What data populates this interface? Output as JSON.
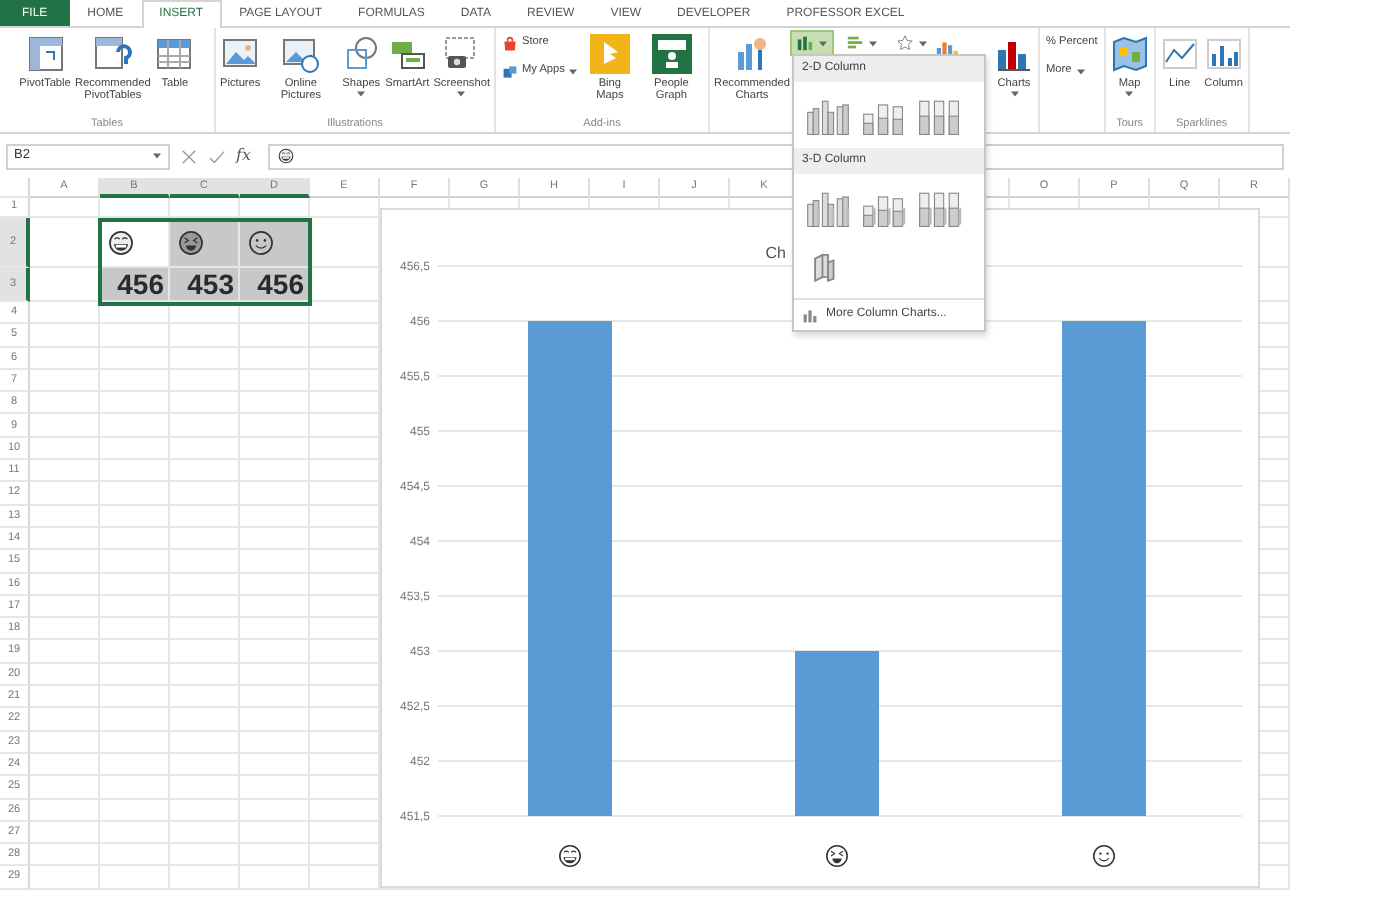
{
  "tabs": [
    {
      "label": "FILE",
      "kind": "file",
      "selected": false
    },
    {
      "label": "HOME",
      "kind": "tab",
      "selected": false
    },
    {
      "label": "INSERT",
      "kind": "tab",
      "selected": true
    },
    {
      "label": "PAGE LAYOUT",
      "kind": "tab",
      "selected": false
    },
    {
      "label": "FORMULAS",
      "kind": "tab",
      "selected": false
    },
    {
      "label": "DATA",
      "kind": "tab",
      "selected": false
    },
    {
      "label": "REVIEW",
      "kind": "tab",
      "selected": false
    },
    {
      "label": "VIEW",
      "kind": "tab",
      "selected": false
    },
    {
      "label": "DEVELOPER",
      "kind": "tab",
      "selected": false
    },
    {
      "label": "PROFESSOR EXCEL",
      "kind": "tab",
      "selected": false
    }
  ],
  "ribbon": {
    "groups": [
      {
        "label": "Tables",
        "buttons": [
          {
            "label": "PivotTable",
            "kind": "large",
            "caret": false,
            "expanded": false
          },
          {
            "label": "Recommended PivotTables",
            "kind": "large",
            "caret": false,
            "expanded": false
          },
          {
            "label": "Table",
            "kind": "large",
            "caret": false,
            "expanded": false
          }
        ]
      },
      {
        "label": "Illustrations",
        "buttons": [
          {
            "label": "Pictures",
            "kind": "large",
            "caret": false,
            "expanded": false
          },
          {
            "label": "Online Pictures",
            "kind": "large",
            "caret": false,
            "expanded": false
          },
          {
            "label": "Shapes",
            "kind": "large",
            "caret": true,
            "expanded": false
          },
          {
            "label": "SmartArt",
            "kind": "large",
            "caret": false,
            "expanded": false
          },
          {
            "label": "Screenshot",
            "kind": "large",
            "caret": true,
            "expanded": false
          }
        ]
      },
      {
        "label": "Add-ins",
        "buttons": [
          {
            "label": "Store",
            "kind": "small",
            "caret": false,
            "expanded": false
          },
          {
            "label": "My Apps",
            "kind": "small",
            "caret": true,
            "expanded": false
          },
          {
            "label": "Bing Maps",
            "kind": "large",
            "caret": false,
            "expanded": false
          },
          {
            "label": "People Graph",
            "kind": "large",
            "caret": false,
            "expanded": false
          }
        ]
      },
      {
        "buttons": [
          {
            "label": "Recommended Charts",
            "kind": "large",
            "caret": false,
            "expanded": false
          },
          {
            "kind": "split",
            "caret": true,
            "expanded": true
          },
          {
            "kind": "split",
            "caret": true,
            "expanded": false
          },
          {
            "kind": "split",
            "caret": true,
            "expanded": false
          },
          {
            "kind": "icon",
            "caret": false,
            "expanded": false
          },
          {
            "label": "Charts",
            "kind": "large",
            "caret": true,
            "expanded": false
          }
        ]
      },
      {
        "buttons": [
          {
            "label": "% Percent",
            "kind": "small",
            "caret": false,
            "expanded": false
          },
          {
            "label": "More",
            "kind": "small",
            "caret": true,
            "expanded": false
          }
        ]
      },
      {
        "label": "Tours",
        "buttons": [
          {
            "label": "Map",
            "kind": "large",
            "caret": true,
            "expanded": false
          }
        ]
      },
      {
        "label": "Sparklines",
        "buttons": [
          {
            "label": "Line",
            "kind": "large",
            "caret": false,
            "expanded": false
          },
          {
            "label": "Column",
            "kind": "large",
            "caret": false,
            "expanded": false
          }
        ]
      }
    ]
  },
  "formula_bar": {
    "name_box": "B2",
    "function_label": "fx"
  },
  "sheet": {
    "columns": [
      "A",
      "B",
      "C",
      "D",
      "E",
      "F",
      "G",
      "H",
      "I",
      "J",
      "K",
      null,
      null,
      null,
      "O",
      "P",
      "Q",
      "R"
    ],
    "rows": [
      "1",
      "2",
      "3",
      "4",
      "5",
      "6",
      "7",
      "8",
      "9",
      "10",
      "11",
      "12",
      "13",
      "14",
      "15",
      "16",
      "17",
      "18",
      "19",
      "20",
      "21",
      "22",
      "23",
      "24",
      "25",
      "26",
      "27",
      "28",
      "29"
    ],
    "emoji_cells": [
      {
        "selected": true,
        "active": true
      },
      {
        "selected": true,
        "active": false
      },
      {
        "selected": true,
        "active": false
      }
    ],
    "value_cells": [
      {
        "value": "456",
        "selected": true
      },
      {
        "value": "453",
        "selected": true
      },
      {
        "value": "456",
        "selected": true
      }
    ]
  },
  "chart": {
    "chart_data": {
      "type": "bar",
      "title": "Ch",
      "grid": true,
      "series": [
        {
          "color": "#5b9bd5",
          "values": [
            456,
            453,
            456
          ]
        }
      ],
      "ylim": [
        451.5,
        456.5
      ],
      "yticks": [
        {
          "value": 451.5,
          "label": "451,5"
        },
        {
          "value": 452,
          "label": "452"
        },
        {
          "value": 452.5,
          "label": "452,5"
        },
        {
          "value": 453,
          "label": "453"
        },
        {
          "value": 453.5,
          "label": "453,5"
        },
        {
          "value": 454,
          "label": "454"
        },
        {
          "value": 454.5,
          "label": "454,5"
        },
        {
          "value": 455,
          "label": "455"
        },
        {
          "value": 455.5,
          "label": "455,5"
        },
        {
          "value": 456,
          "label": "456"
        },
        {
          "value": 456.5,
          "label": "456,5"
        }
      ]
    }
  },
  "menu": {
    "sections": [
      {
        "header": "2-D Column",
        "options": [
          {
            "kind": "clustered"
          },
          {
            "kind": "stacked"
          },
          {
            "kind": "stacked100"
          }
        ]
      },
      {
        "header": "3-D Column",
        "options": [
          {
            "kind": "clustered_3d"
          },
          {
            "kind": "stacked_3d"
          },
          {
            "kind": "stacked100_3d"
          },
          {
            "kind": "column_3d"
          }
        ]
      }
    ],
    "footer": "More Column Charts..."
  }
}
